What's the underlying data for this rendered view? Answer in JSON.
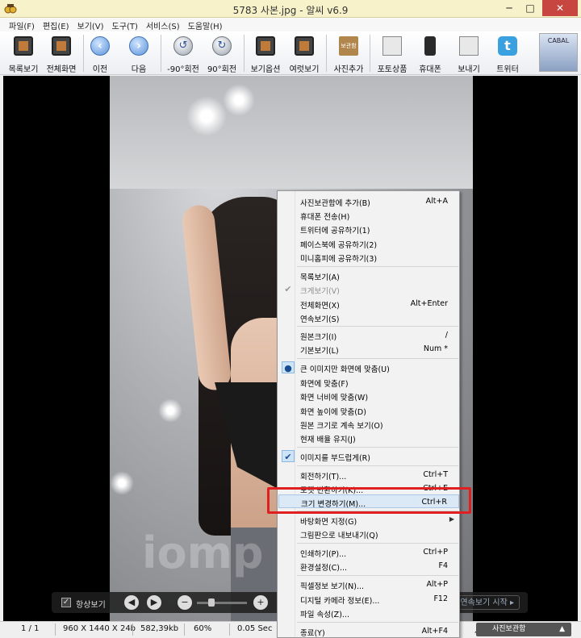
{
  "window": {
    "title": "5783 사본.jpg - 알씨 v6.9",
    "minimize_glyph": "─",
    "maximize_glyph": "□",
    "close_glyph": "✕"
  },
  "menubar": [
    {
      "label": "파일(F)"
    },
    {
      "label": "편집(E)"
    },
    {
      "label": "보기(V)"
    },
    {
      "label": "도구(T)"
    },
    {
      "label": "서비스(S)"
    },
    {
      "label": "도움말(H)"
    }
  ],
  "toolbar": {
    "list_view": "목록보기",
    "fullscreen": "전체화면",
    "prev": "이전",
    "next": "다음",
    "rotate_left": "-90°회전",
    "rotate_right": "90°회전",
    "view_options": "보기옵션",
    "multi_view": "여럿보기",
    "add_photo": "사진추가",
    "add_photo_badge": "보관함",
    "photo_product": "포토상품",
    "mobile": "휴대폰",
    "send": "보내기",
    "twitter": "트위터",
    "ad_text": "CABAL"
  },
  "context_menu": {
    "items": [
      {
        "label": "사진보관함에 추가(B)",
        "shortcut": "Alt+A"
      },
      {
        "label": "휴대폰 전송(H)",
        "shortcut": ""
      },
      {
        "label": "트위터에 공유하기(1)",
        "shortcut": ""
      },
      {
        "label": "페이스북에 공유하기(2)",
        "shortcut": ""
      },
      {
        "label": "미니홈피에 공유하기(3)",
        "shortcut": ""
      },
      {
        "label": "목록보기(A)",
        "shortcut": ""
      },
      {
        "label": "크게보기(V)",
        "shortcut": ""
      },
      {
        "label": "전체화면(X)",
        "shortcut": "Alt+Enter"
      },
      {
        "label": "연속보기(S)",
        "shortcut": ""
      },
      {
        "label": "원본크기(I)",
        "shortcut": "/"
      },
      {
        "label": "기본보기(L)",
        "shortcut": "Num *"
      },
      {
        "label": "큰 이미지만 화면에 맞춤(U)",
        "shortcut": ""
      },
      {
        "label": "화면에 맞춤(F)",
        "shortcut": ""
      },
      {
        "label": "화면 너비에 맞춤(W)",
        "shortcut": ""
      },
      {
        "label": "화면 높이에 맞춤(D)",
        "shortcut": ""
      },
      {
        "label": "원본 크기로 계속 보기(O)",
        "shortcut": ""
      },
      {
        "label": "현재 배율 유지(J)",
        "shortcut": ""
      },
      {
        "label": "이미지를 부드럽게(R)",
        "shortcut": ""
      },
      {
        "label": "회전하기(T)...",
        "shortcut": "Ctrl+T"
      },
      {
        "label": "포맷 변환하기(K)...",
        "shortcut": "Ctrl+E"
      },
      {
        "label": "크기 변경하기(M)...",
        "shortcut": "Ctrl+R"
      },
      {
        "label": "바탕화면 지정(G)",
        "shortcut": ""
      },
      {
        "label": "그림판으로 내보내기(Q)",
        "shortcut": ""
      },
      {
        "label": "인쇄하기(P)...",
        "shortcut": "Ctrl+P"
      },
      {
        "label": "환경설정(C)...",
        "shortcut": "F4"
      },
      {
        "label": "픽셀정보 보기(N)...",
        "shortcut": "Alt+P"
      },
      {
        "label": "디지털 카메라 정보(E)...",
        "shortcut": "F12"
      },
      {
        "label": "파일 속성(Z)...",
        "shortcut": ""
      },
      {
        "label": "종료(Y)",
        "shortcut": "Alt+F4"
      }
    ],
    "check_glyph": "✔",
    "radio_glyph": "●",
    "submenu_glyph": "▶"
  },
  "viewer": {
    "watermark": "iomp",
    "bottombar": {
      "always_view": "항상보기",
      "check_glyph": "✓",
      "prev_glyph": "◀",
      "next_glyph": "▶",
      "zoom_out": "−",
      "zoom_in": "+",
      "slideshow_start": "연속보기 시작 ▸"
    }
  },
  "statusbar": {
    "page": "1 / 1",
    "dimensions": "960 X 1440 X 24b",
    "filesize": "582,39kb",
    "zoom": "60%",
    "time": "0.05 Sec",
    "photo_album": "사진보관함",
    "album_prefix": "사",
    "album_arrow": "▲"
  }
}
